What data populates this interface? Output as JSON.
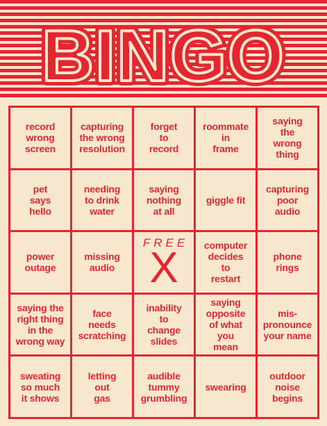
{
  "header": {
    "title": "BINGO"
  },
  "colors": {
    "accent": "#e3262f",
    "background": "#f8e7cf"
  },
  "free_space": {
    "label": "FREE",
    "mark": "X"
  },
  "cells": [
    "record\nwrong\nscreen",
    "capturing\nthe wrong\nresolution",
    "forget\nto\nrecord",
    "roommate\nin\nframe",
    "saying\nthe\nwrong\nthing",
    "pet\nsays\nhello",
    "needing\nto drink\nwater",
    "saying\nnothing\nat all",
    "giggle fit",
    "capturing\npoor\naudio",
    "power\noutage",
    "missing\naudio",
    "FREE",
    "computer\ndecides\nto\nrestart",
    "phone\nrings",
    "saying the\nright thing\nin the\nwrong way",
    "face\nneeds\nscratching",
    "inability\nto\nchange\nslides",
    "saying\nopposite\nof what\nyou\nmean",
    "mis-\npronounce\nyour name",
    "sweating\nso much\nit shows",
    "letting\nout\ngas",
    "audible\ntummy\ngrumbling",
    "swearing",
    "outdoor\nnoise\nbegins"
  ]
}
